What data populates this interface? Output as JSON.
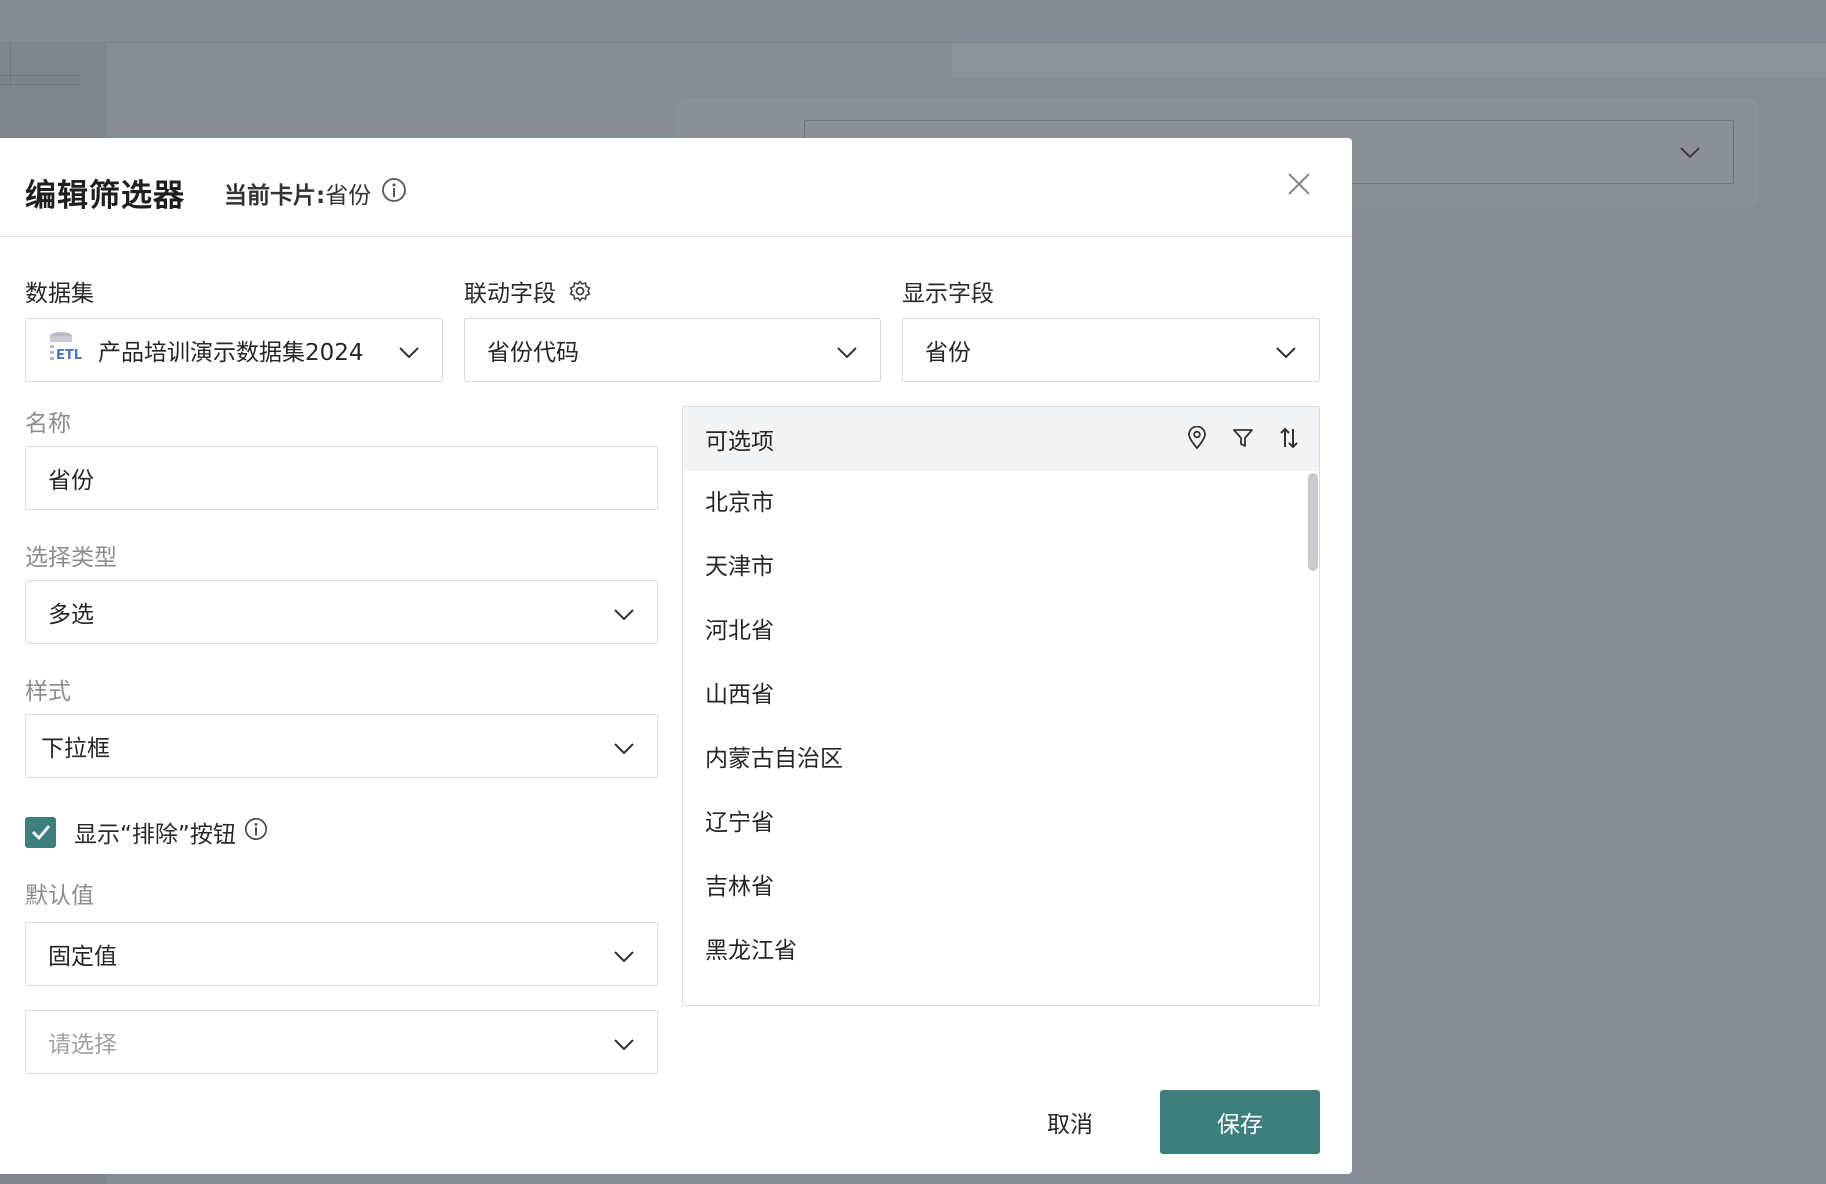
{
  "modal": {
    "title": "编辑筛选器",
    "current_card_label": "当前卡片:",
    "current_card_value": "省份"
  },
  "dataset": {
    "label": "数据集",
    "value": "产品培训演示数据集2024",
    "icon": "etl-dataset-icon"
  },
  "link_field": {
    "label": "联动字段",
    "value": "省份代码"
  },
  "display_field": {
    "label": "显示字段",
    "value": "省份"
  },
  "name": {
    "label": "名称",
    "value": "省份"
  },
  "select_type": {
    "label": "选择类型",
    "value": "多选"
  },
  "style": {
    "label": "样式",
    "value": "下拉框"
  },
  "exclude_checkbox": {
    "label": "显示“排除”按钮",
    "checked": true
  },
  "default_value": {
    "label": "默认值",
    "value": "固定值",
    "picker_placeholder": "请选择"
  },
  "options": {
    "header": "可选项",
    "items": [
      "北京市",
      "天津市",
      "河北省",
      "山西省",
      "内蒙古自治区",
      "辽宁省",
      "吉林省",
      "黑龙江省"
    ]
  },
  "footer": {
    "cancel_label": "取消",
    "save_label": "保存"
  },
  "colors": {
    "accent": "#3d7f7c",
    "overlay": "#868c94"
  }
}
